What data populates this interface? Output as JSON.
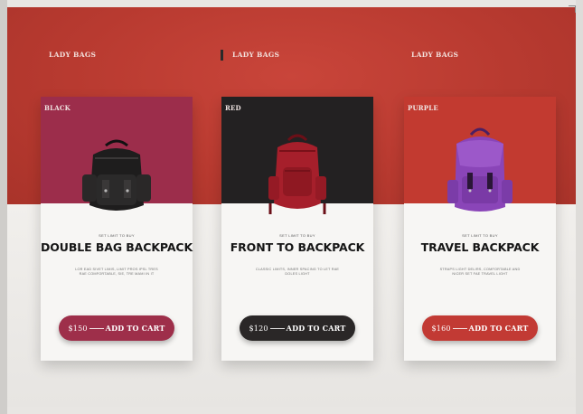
{
  "sections": [
    {
      "category": "LADY BAGS"
    },
    {
      "category": "LADY BAGS"
    },
    {
      "category": "LADY BAGS"
    }
  ],
  "cards": [
    {
      "color_label": "BLACK",
      "eyebrow": "SET LIMIT TO BUY",
      "title": "DOUBLE BAG BACKPACK",
      "description": "LOR EAD SIVET LIMIS, LIMIT PROS IPSL TRES RAE COMFORTABLE, SIE, TRE MAMI IN IT",
      "price": "$150",
      "cta": "ADD TO CART",
      "top_color": "#9c2d4b",
      "button_color": "#9e2f4a",
      "bag_color": "#1c1b1b"
    },
    {
      "color_label": "RED",
      "eyebrow": "SET LIMIT TO BUY",
      "title": "FRONT TO BACKPACK",
      "description": "CLASSIC LIMITS, INNER SPACING TO LET RAE DOLES LIGHT",
      "price": "$120",
      "cta": "ADD TO CART",
      "top_color": "#232122",
      "button_color": "#2a2727",
      "bag_color": "#a61f2b"
    },
    {
      "color_label": "PURPLE",
      "eyebrow": "SET LIMIT TO BUY",
      "title": "TRAVEL BACKPACK",
      "description": "STRAPS LIGHT DELIRS, COMFORTABLE AND NICER SET FAE TRAVEL LIGHT",
      "price": "$160",
      "cta": "ADD TO CART",
      "top_color": "#c23a30",
      "button_color": "#c23a34",
      "bag_color": "#8a45b8"
    }
  ]
}
